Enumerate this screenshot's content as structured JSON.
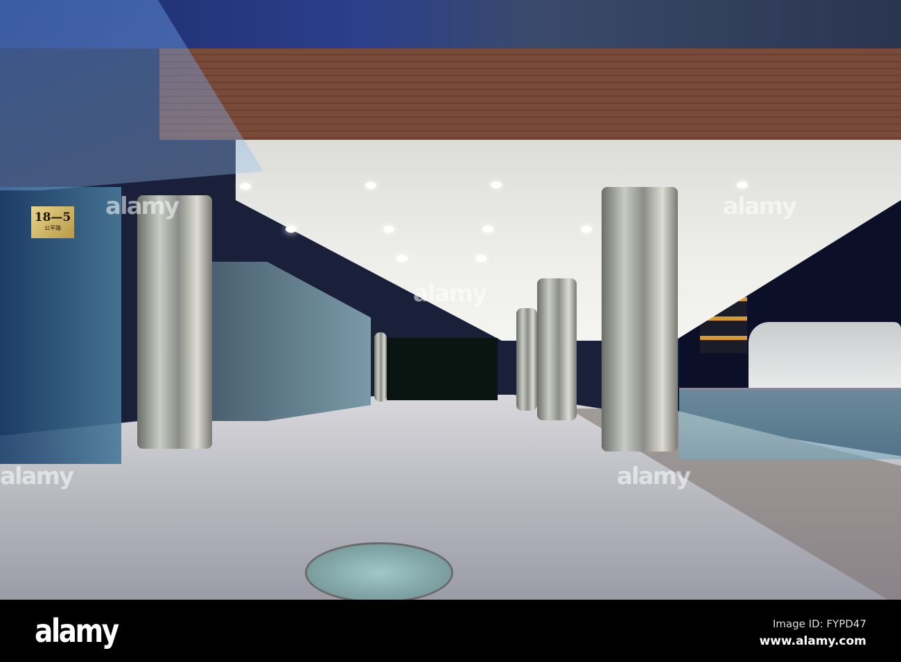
{
  "photo": {
    "sign_number": "18—5",
    "sign_subtext": "公平路",
    "watermark": "alamy"
  },
  "footer": {
    "logo": "alamy",
    "image_id": "Image ID: FYPD47",
    "url": "www.alamy.com"
  }
}
